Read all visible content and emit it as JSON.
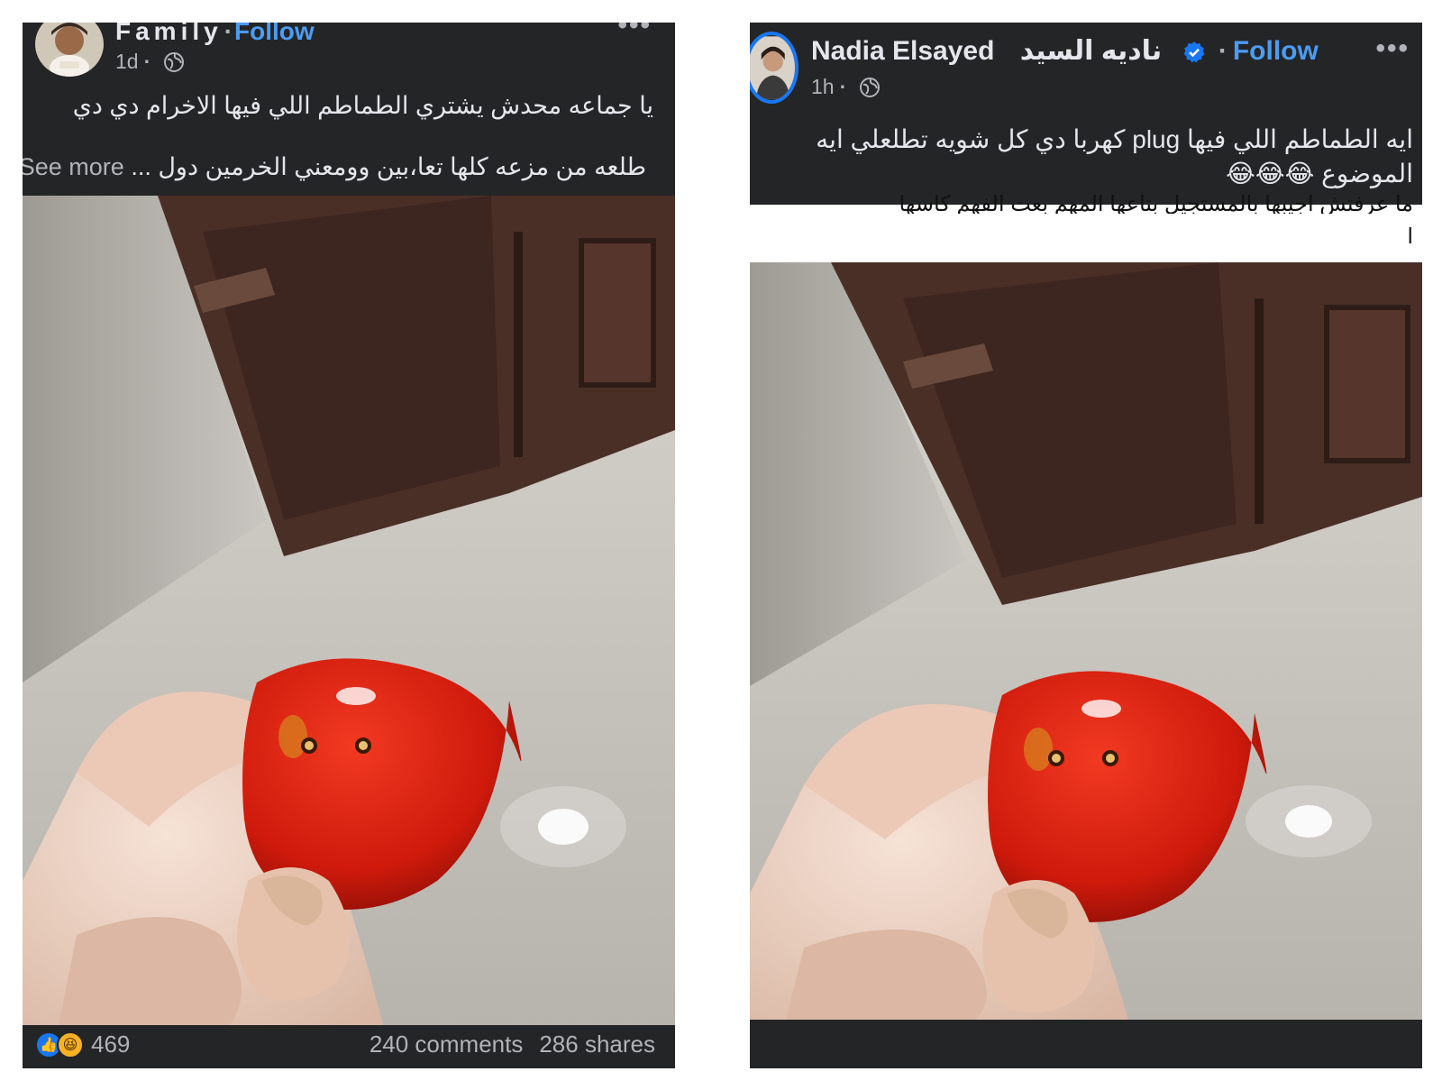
{
  "left_post": {
    "author": "Family",
    "follow_label": "Follow",
    "separator": "·",
    "time": "1d",
    "privacy_icon": "globe-icon",
    "more_label": "•••",
    "caption_line1": "يا جماعه محدش يشتري الطماطم اللي فيها الاخرام دي دي",
    "caption_line2": "طلعه من مزعه كلها تعا،بين وومعني الخرمين دول ...",
    "see_more_label": "See more",
    "reaction_icons": [
      "like-icon",
      "haha-icon"
    ],
    "reaction_count": "469",
    "comments": "240 comments",
    "shares": "286 shares"
  },
  "right_post": {
    "author": "Nadia Elsayed",
    "author_arabic": "ناديه السيد",
    "verified_icon": "verified-badge-icon",
    "follow_label": "Follow",
    "separator": "·",
    "time": "1h",
    "privacy_icon": "globe-icon",
    "more_label": "•••",
    "caption_line1": "ايه الطماطم اللي فيها plug كهربا  دي كل شويه تطلعلي ايه",
    "caption_line2": "الموضوع 😂😂😂",
    "partial_comment_line1": "ما عرفتش اجيبها بالمستجيل بتاعها المهم بعت الفهم كاسها",
    "partial_comment_line2": "ا"
  },
  "colors": {
    "card_bg": "#242526",
    "text": "#e4e6eb",
    "muted": "#b0b3b8",
    "link": "#4a9cf5",
    "tomato": "#d81e10"
  }
}
